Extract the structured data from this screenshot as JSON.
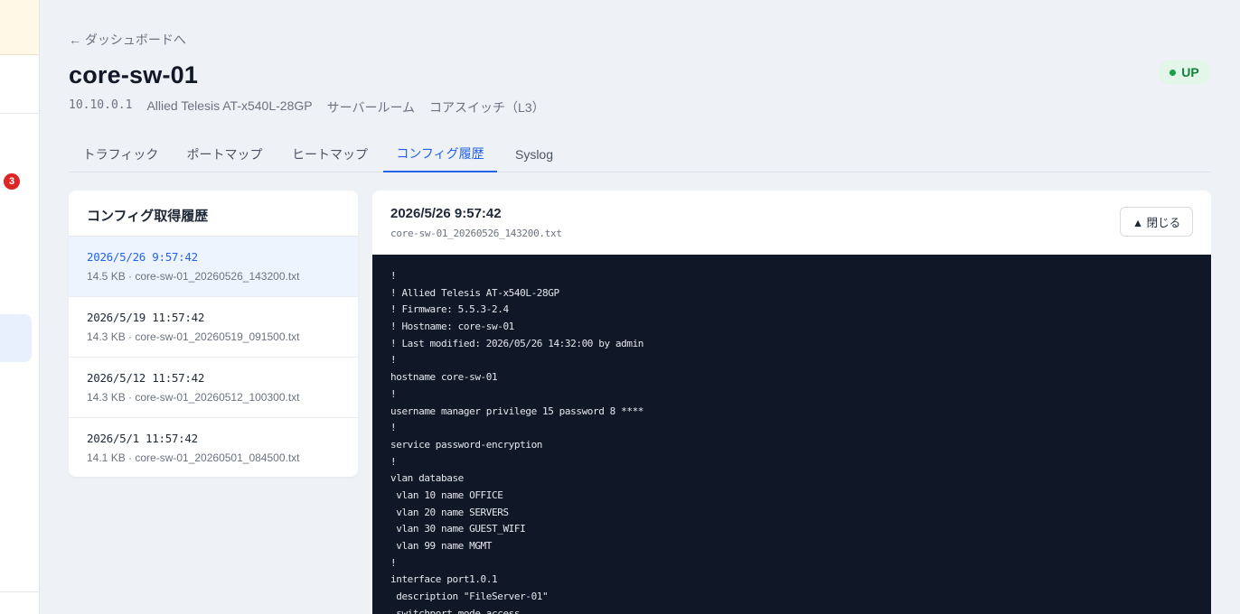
{
  "sidebar": {
    "badge_count": "3"
  },
  "nav": {
    "back_label": "← ダッシュボードへ"
  },
  "device": {
    "name": "core-sw-01",
    "ip": "10.10.0.1",
    "model": "Allied Telesis AT-x540L-28GP",
    "location": "サーバールーム",
    "role": "コアスイッチ（L3）",
    "status": "UP",
    "status_color": "#16a34a"
  },
  "tabs": [
    {
      "label": "トラフィック"
    },
    {
      "label": "ポートマップ"
    },
    {
      "label": "ヒートマップ"
    },
    {
      "label": "コンフィグ履歴",
      "active": true
    },
    {
      "label": "Syslog"
    }
  ],
  "history": {
    "title": "コンフィグ取得履歴",
    "items": [
      {
        "date": "2026/5/26 9:57:42",
        "info": "14.5 KB · core-sw-01_20260526_143200.txt",
        "selected": true
      },
      {
        "date": "2026/5/19 11:57:42",
        "info": "14.3 KB · core-sw-01_20260519_091500.txt"
      },
      {
        "date": "2026/5/12 11:57:42",
        "info": "14.3 KB · core-sw-01_20260512_100300.txt"
      },
      {
        "date": "2026/5/1 11:57:42",
        "info": "14.1 KB · core-sw-01_20260501_084500.txt"
      }
    ]
  },
  "viewer": {
    "date": "2026/5/26 9:57:42",
    "filename": "core-sw-01_20260526_143200.txt",
    "close_label": "▲ 閉じる",
    "lines": [
      "!",
      "! Allied Telesis AT-x540L-28GP",
      "! Firmware: 5.5.3-2.4",
      "! Hostname: core-sw-01",
      "! Last modified: 2026/05/26 14:32:00 by admin",
      "!",
      "hostname core-sw-01",
      "!",
      "username manager privilege 15 password 8 ****",
      "!",
      "service password-encryption",
      "!",
      "vlan database",
      " vlan 10 name OFFICE",
      " vlan 20 name SERVERS",
      " vlan 30 name GUEST_WIFI",
      " vlan 99 name MGMT",
      "!",
      "interface port1.0.1",
      " description \"FileServer-01\"",
      " switchport mode access"
    ]
  }
}
